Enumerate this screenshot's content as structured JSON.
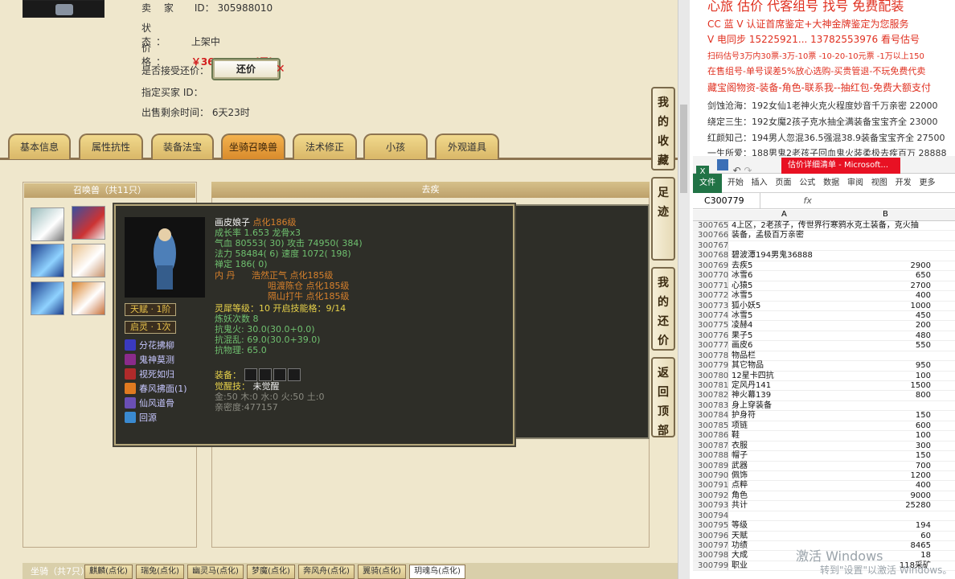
{
  "listing": {
    "seller_label": "卖  家",
    "seller_id_label": "ID：",
    "seller_id": "305988010",
    "status_label": "状  态：",
    "status_value": "上架中",
    "price_label": "价  格：",
    "price_value": "￥36888.00 (元)",
    "haggle_label": "是否接受还价：",
    "haggle_button": "还价",
    "buyer_label": "指定买家 ID：",
    "remaining_label": "出售剩余时间：",
    "remaining_value": "6天23时"
  },
  "tabs": [
    "基本信息",
    "属性抗性",
    "装备法宝",
    "坐骑召唤兽",
    "法术修正",
    "小孩",
    "外观道具"
  ],
  "active_tab": "坐骑召唤兽",
  "pets_panel": {
    "title": "召唤兽（共11只）"
  },
  "right_panel": {
    "title": "去疾"
  },
  "popup": {
    "name": "画皮娘子",
    "name_suffix": "点化186级",
    "growth": "成长率 1.653 龙骨x3",
    "hp": "气血 80553( 30) 攻击 74950( 384)",
    "mp": "法力 58484( 6) 速度 1072( 198)",
    "zen": "禅定 186( 0)",
    "core1_label": "内  丹",
    "core1": "浩然正气 点化185级",
    "core2": "咀渡陈仓 点化185级",
    "core3": "隔山打牛 点化185级",
    "spirit": "灵犀等级：10 开启技能格：9/14",
    "refine": "炼妖次数 8",
    "resist1": "抗鬼火: 30.0(30.0+0.0)",
    "resist2": "抗混乱: 69.0(30.0+39.0)",
    "resist3": "抗物理: 65.0",
    "equip_label": "装备：",
    "awaken_label": "觉醒技：",
    "awaken_value": "未觉醒",
    "elements": "金:50 木:0 水:0 火:50 土:0",
    "intimacy": "亲密度:477157",
    "talent": "天赋 · 1阶",
    "enlight": "启灵 · 1次",
    "skills": [
      "分花拂柳",
      "鬼神莫测",
      "视死如归",
      "春风拂面(1)",
      "仙风道骨",
      "回源"
    ]
  },
  "side_buttons": [
    "我的收藏",
    "足迹",
    "我的还价",
    "返回顶部"
  ],
  "bottom": {
    "title": "坐骑（共7只）",
    "tabs": [
      "麒麟(点化)",
      "瑞兔(点化)",
      "幽灵马(点化)",
      "梦魔(点化)",
      "奔风舟(点化)",
      "翼骑(点化)",
      "玥魂鸟(点化)"
    ]
  },
  "ads": [
    "心旅 估价 代客组号 找号 免费配装",
    "CC 蓝 V 认证首席鉴定+大神金牌鉴定为您服务",
    "V 电同步 15225921... 13782553976 看号估号",
    "扫码估号3万内30票-3万-10票 -10-20-10元票 -1万以上150",
    "在售组号-单号误差5%放心选购-买贵管退-不玩免费代卖",
    "藏宝阁物资-装备-角色-联系我--抽红包-免费大额支付"
  ],
  "listings": [
    "剑蚀沧海：192女仙1老神火克火程度妙音千万亲密 22000",
    "绕定三生：192女魔2孩子克水抽全满装备宝宝齐全 23000",
    "红颜知己：194男人忽混36.5强混38.9装备宝宝齐全 27500",
    "一生所爱：188男鬼2老孩子回血鬼火装柔极去疾百万 28888"
  ],
  "excel": {
    "title": "估价详细清单 - Microsoft...",
    "ribbon": [
      "文件",
      "开始",
      "插入",
      "页面",
      "公式",
      "数据",
      "审阅",
      "视图",
      "开发",
      "更多"
    ],
    "cell_ref": "C300779",
    "fx": "fx",
    "col_a": "A",
    "col_b": "B",
    "rows": [
      {
        "n": "300765",
        "a": "4上区，2老孩子，传世界行寒鸦水克土装备，克火抽",
        "b": ""
      },
      {
        "n": "300766",
        "a": "装备，孟极百万亲密",
        "b": ""
      },
      {
        "n": "300767",
        "a": "",
        "b": ""
      },
      {
        "n": "300768",
        "a": "碧波潭194男鬼36888",
        "b": ""
      },
      {
        "n": "300769",
        "a": "去疾5",
        "b": "2900"
      },
      {
        "n": "300770",
        "a": "冰雪6",
        "b": "650"
      },
      {
        "n": "300771",
        "a": "心猿5",
        "b": "2700"
      },
      {
        "n": "300772",
        "a": "冰雪5",
        "b": "400"
      },
      {
        "n": "300773",
        "a": "狐小妖5",
        "b": "1000"
      },
      {
        "n": "300774",
        "a": "冰雪5",
        "b": "450"
      },
      {
        "n": "300775",
        "a": "凌赫4",
        "b": "200"
      },
      {
        "n": "300776",
        "a": "果子5",
        "b": "480"
      },
      {
        "n": "300777",
        "a": "画皮6",
        "b": "550"
      },
      {
        "n": "300778",
        "a": "物品栏",
        "b": ""
      },
      {
        "n": "300779",
        "a": "其它物品",
        "b": "950"
      },
      {
        "n": "300780",
        "a": "12星卡四抗",
        "b": "100"
      },
      {
        "n": "300781",
        "a": "定风丹141",
        "b": "1500"
      },
      {
        "n": "300782",
        "a": "神火幕139",
        "b": "800"
      },
      {
        "n": "300783",
        "a": "身上穿装备",
        "b": ""
      },
      {
        "n": "300784",
        "a": "护身符",
        "b": "150"
      },
      {
        "n": "300785",
        "a": "项链",
        "b": "600"
      },
      {
        "n": "300786",
        "a": "鞋",
        "b": "100"
      },
      {
        "n": "300787",
        "a": "衣服",
        "b": "300"
      },
      {
        "n": "300788",
        "a": "帽子",
        "b": "150"
      },
      {
        "n": "300789",
        "a": "武器",
        "b": "700"
      },
      {
        "n": "300790",
        "a": "佩饰",
        "b": "1200"
      },
      {
        "n": "300791",
        "a": "点粹",
        "b": "400"
      },
      {
        "n": "300792",
        "a": "角色",
        "b": "9000"
      },
      {
        "n": "300793",
        "a": "共计",
        "b": "25280"
      },
      {
        "n": "300794",
        "a": "",
        "b": ""
      },
      {
        "n": "300795",
        "a": "等级",
        "b": "194"
      },
      {
        "n": "300796",
        "a": "天赋",
        "b": "60"
      },
      {
        "n": "300797",
        "a": "功绩",
        "b": "8465"
      },
      {
        "n": "300798",
        "a": "大成",
        "b": "18"
      },
      {
        "n": "300799",
        "a": "职业",
        "b": "118采矿"
      }
    ]
  },
  "watermark": {
    "line1": "激活 Windows",
    "line2": "转到\"设置\"以激活 Windows。"
  }
}
